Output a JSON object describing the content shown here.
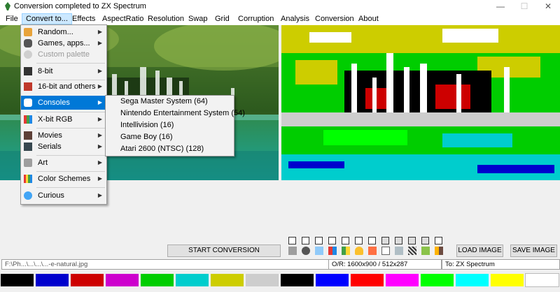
{
  "window": {
    "title": "Conversion completed to ZX Spectrum",
    "controls": [
      "—",
      "☐",
      "✕"
    ]
  },
  "menubar": [
    "File",
    "Convert to...",
    "Effects",
    "AspectRatio",
    "Resolution",
    "Swap",
    "Grid",
    "Corruption",
    "Analysis",
    "Conversion",
    "About"
  ],
  "convert_menu": [
    {
      "label": "Random...",
      "icon": "dice-icon",
      "arrow": true
    },
    {
      "label": "Games, apps...",
      "icon": "gamepad-icon",
      "arrow": true
    },
    {
      "label": "Custom palette",
      "icon": "palette-icon",
      "arrow": false,
      "disabled": true
    },
    {
      "label": "8-bit",
      "icon": "computer-icon",
      "arrow": true
    },
    {
      "label": "16-bit and others",
      "icon": "monitor-icon",
      "arrow": true
    },
    {
      "label": "Consoles",
      "icon": "console-icon",
      "arrow": true,
      "selected": true
    },
    {
      "label": "X-bit RGB",
      "icon": "rgb-icon",
      "arrow": true
    },
    {
      "label": "Movies",
      "icon": "film-icon",
      "arrow": true
    },
    {
      "label": "Serials",
      "icon": "tv-icon",
      "arrow": true
    },
    {
      "label": "Art",
      "icon": "brush-icon",
      "arrow": true
    },
    {
      "label": "Color Schemes",
      "icon": "color-bars-icon",
      "arrow": true
    },
    {
      "label": "Curious",
      "icon": "globe-icon",
      "arrow": true
    }
  ],
  "consoles_submenu": [
    "Sega Master System (64)",
    "Nintendo Entertainment System (54)",
    "Intellivision (16)",
    "Game Boy (16)",
    "Atari 2600 (NTSC) (128)"
  ],
  "buttons": {
    "start": "START CONVERSION",
    "load": "LOAD IMAGE",
    "save": "SAVE IMAGE"
  },
  "status": {
    "path": "F:\\Ph...\\...\\...\\...-e-natural.jpg",
    "size": "O/R:   1600x900 / 512x287",
    "target": "To:  ZX Spectrum"
  },
  "palette": [
    "#000000",
    "#0000cd",
    "#cd0000",
    "#cd00cd",
    "#00cd00",
    "#00cdcd",
    "#cdcd00",
    "#cdcdcd",
    "#000000",
    "#0000ff",
    "#ff0000",
    "#ff00ff",
    "#00ff00",
    "#00ffff",
    "#ffff00",
    "#ffffff"
  ]
}
